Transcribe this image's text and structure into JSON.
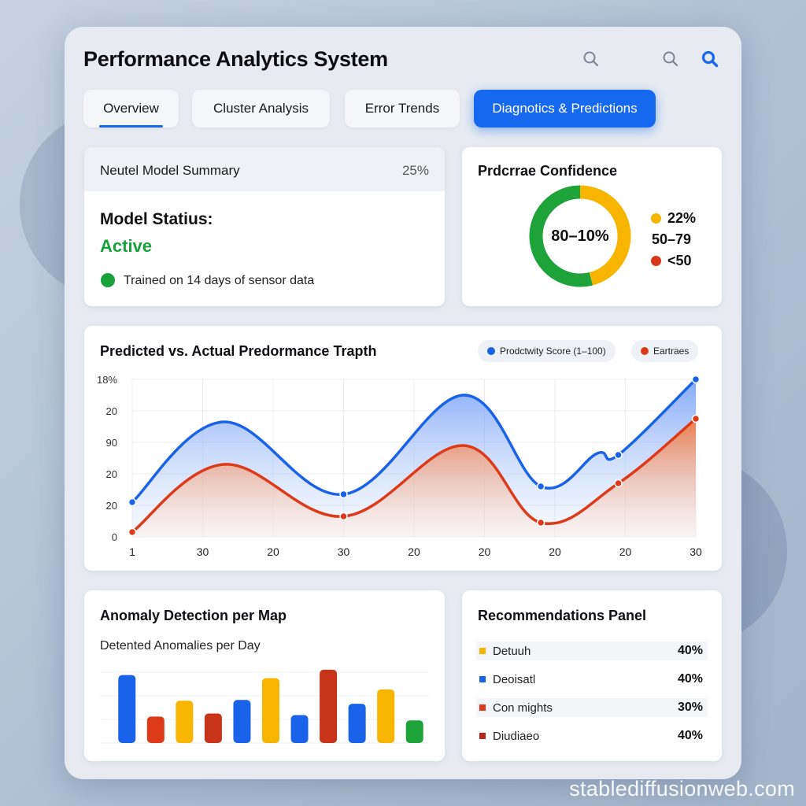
{
  "app": {
    "title": "Performance Analytics System"
  },
  "header": {
    "icons": [
      "search-icon",
      "search-icon",
      "search-icon"
    ],
    "accent": "#1668ef"
  },
  "tabs": [
    {
      "label": "Overview"
    },
    {
      "label": "Cluster Analysis"
    },
    {
      "label": "Error Trends"
    },
    {
      "label": "Diagnotics & Predictions"
    }
  ],
  "summary": {
    "label": "Neutel Model Summary",
    "percent": "25%",
    "status_title": "Model Statius:",
    "status_value": "Active",
    "note": "Trained on 14 days of sensor data"
  },
  "confidence": {
    "title": "Prdcrrae Confidence",
    "center_label": "80–10%",
    "legend": [
      {
        "label": "22%",
        "color": "#f7b500"
      },
      {
        "label": "50–79",
        "color": "#1ea33b"
      },
      {
        "label": "<50",
        "color": "#d93818"
      }
    ]
  },
  "trend_chart": {
    "title": "Predicted vs. Actual Predormance Trapth",
    "legend": [
      {
        "label": "Prodctwity Score (1–100)",
        "color": "#1a62e8"
      },
      {
        "label": "Eartraes",
        "color": "#dd3a1a"
      }
    ]
  },
  "anomaly": {
    "title": "Anomaly Detection per Map",
    "subtitle": "Detented Anomalies per Day"
  },
  "recommendations": {
    "title": "Recommendations Panel",
    "items": [
      {
        "label": "Detuuh",
        "value": "40%",
        "color": "#f7b500"
      },
      {
        "label": "Deoisatl",
        "value": "40%",
        "color": "#1a62e8"
      },
      {
        "label": "Con mights",
        "value": "30%",
        "color": "#dd3a1a"
      },
      {
        "label": "Diudiaeo",
        "value": "40%",
        "color": "#b8281a"
      }
    ]
  },
  "chart_data": [
    {
      "type": "pie",
      "title": "Prdcrrae Confidence",
      "labels": [
        "22%",
        "50–79",
        "<50"
      ],
      "values": [
        46,
        54,
        0
      ],
      "center_label": "80–10%",
      "colors": [
        "#f7b500",
        "#1ea33b",
        "#d93818"
      ]
    },
    {
      "type": "area",
      "title": "Predicted vs. Actual Predormance Trapth",
      "x_tick_labels": [
        "1",
        "30",
        "20",
        "30",
        "20",
        "20",
        "20",
        "20",
        "30"
      ],
      "y_tick_labels": [
        "18%",
        "20",
        "90",
        "20",
        "20",
        "0"
      ],
      "ylim": [
        0,
        100
      ],
      "series": [
        {
          "name": "Prodctwity Score (1–100)",
          "color": "#1a62e8",
          "points": [
            [
              0,
              22
            ],
            [
              1.3,
              73
            ],
            [
              3,
              27
            ],
            [
              4.7,
              90
            ],
            [
              5.8,
              32
            ],
            [
              6.6,
              53
            ],
            [
              6.9,
              52
            ],
            [
              8,
              100
            ]
          ]
        },
        {
          "name": "Eartraes",
          "color": "#dd3a1a",
          "points": [
            [
              0,
              3
            ],
            [
              1.3,
              46
            ],
            [
              3,
              13
            ],
            [
              4.7,
              58
            ],
            [
              5.8,
              9
            ],
            [
              6.9,
              34
            ],
            [
              8,
              75
            ]
          ]
        }
      ],
      "markers": [
        {
          "series": 0,
          "index": [
            0,
            2,
            4,
            6,
            7
          ]
        },
        {
          "series": 1,
          "index": [
            0,
            2,
            4,
            5,
            6
          ]
        }
      ],
      "grid": true
    },
    {
      "type": "bar",
      "title": "Anomaly Detection per Map",
      "subtitle": "Detented Anomalies per Day",
      "values": [
        90,
        35,
        56,
        39,
        57,
        86,
        37,
        97,
        52,
        71,
        30
      ],
      "colors": [
        "#1a62e8",
        "#dd3a1a",
        "#f7b500",
        "#c73418",
        "#1a62e8",
        "#f7b500",
        "#1a62e8",
        "#c73418",
        "#1a62e8",
        "#f7b500",
        "#1ea33b"
      ],
      "ylim": [
        0,
        100
      ]
    }
  ]
}
